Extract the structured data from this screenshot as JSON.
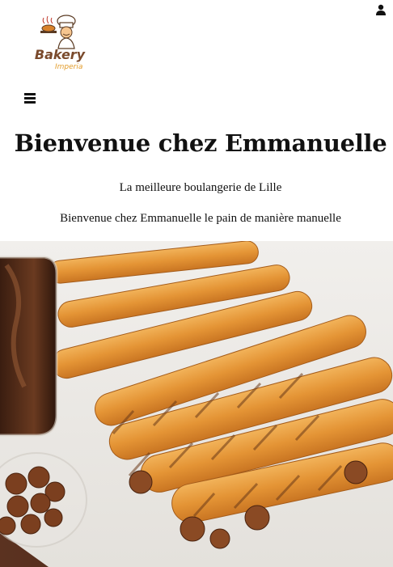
{
  "header": {
    "logo": {
      "name": "Bakery",
      "sub": "Imperia",
      "icon": "chef-logo"
    },
    "user_icon": "user-icon",
    "menu_icon": "hamburger-menu-icon"
  },
  "hero": {
    "title": "Bienvenue chez Emmanuelle",
    "tagline": "La meilleure boulangerie de Lille",
    "subtitle": "Bienvenue chez Emmanuelle le pain de manière manuelle",
    "image": "pastry-twists-photo"
  },
  "colors": {
    "logo_brown": "#7a4a2c",
    "logo_orange": "#e39c2a",
    "text": "#111111"
  }
}
